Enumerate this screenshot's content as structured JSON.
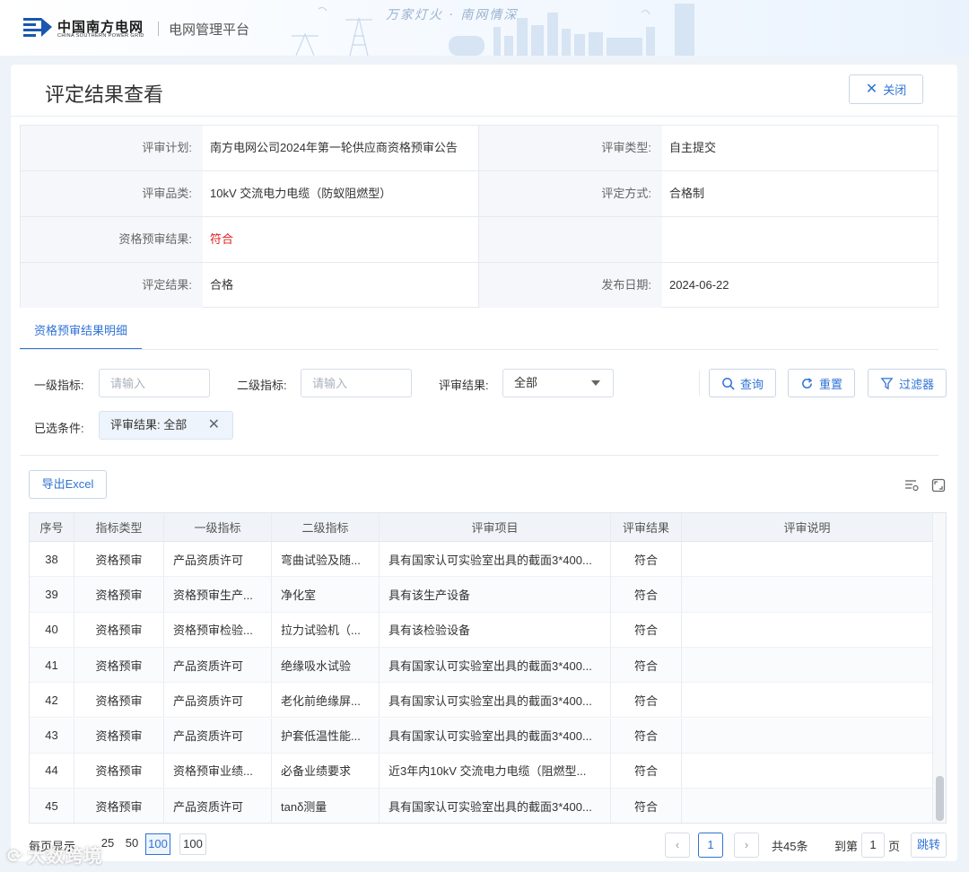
{
  "header": {
    "logo_cn": "中国南方电网",
    "logo_en": "CHINA SOUTHERN POWER GRID",
    "platform": "电网管理平台",
    "slogan": "万家灯火 · 南网情深"
  },
  "page": {
    "title": "评定结果查看",
    "close_label": "关闭"
  },
  "info": {
    "plan_label": "评审计划:",
    "plan_value": "南方电网公司2024年第一轮供应商资格预审公告",
    "type_label": "评审类型:",
    "type_value": "自主提交",
    "category_label": "评审品类:",
    "category_value": "10kV 交流电力电缆（防蚁阻燃型）",
    "method_label": "评定方式:",
    "method_value": "合格制",
    "prequal_label": "资格预审结果:",
    "prequal_value": "符合",
    "result_label": "评定结果:",
    "result_value": "合格",
    "date_label": "发布日期:",
    "date_value": "2024-06-22"
  },
  "tab": {
    "label": "资格预审结果明细"
  },
  "filters": {
    "level1_label": "一级指标:",
    "level1_placeholder": "请输入",
    "level2_label": "二级指标:",
    "level2_placeholder": "请输入",
    "result_label": "评审结果:",
    "result_value": "全部",
    "query_label": "查询",
    "reset_label": "重置",
    "filter_label": "过滤器",
    "selected_label": "已选条件:",
    "chip_text": "评审结果: 全部"
  },
  "toolbar": {
    "export_label": "导出Excel"
  },
  "table": {
    "headers": [
      "序号",
      "指标类型",
      "一级指标",
      "二级指标",
      "评审项目",
      "评审结果",
      "评审说明"
    ],
    "rows": [
      [
        "38",
        "资格预审",
        "产品资质许可",
        "弯曲试验及随...",
        "具有国家认可实验室出具的截面3*400...",
        "符合",
        ""
      ],
      [
        "39",
        "资格预审",
        "资格预审生产...",
        "净化室",
        "具有该生产设备",
        "符合",
        ""
      ],
      [
        "40",
        "资格预审",
        "资格预审检验...",
        "拉力试验机（...",
        "具有该检验设备",
        "符合",
        ""
      ],
      [
        "41",
        "资格预审",
        "产品资质许可",
        "绝缘吸水试验",
        "具有国家认可实验室出具的截面3*400...",
        "符合",
        ""
      ],
      [
        "42",
        "资格预审",
        "产品资质许可",
        "老化前绝缘屏...",
        "具有国家认可实验室出具的截面3*400...",
        "符合",
        ""
      ],
      [
        "43",
        "资格预审",
        "产品资质许可",
        "护套低温性能...",
        "具有国家认可实验室出具的截面3*400...",
        "符合",
        ""
      ],
      [
        "44",
        "资格预审",
        "资格预审业绩...",
        "必备业绩要求",
        "近3年内10kV 交流电力电缆（阻燃型...",
        "符合",
        ""
      ],
      [
        "45",
        "资格预审",
        "产品资质许可",
        "tanδ测量",
        "具有国家认可实验室出具的截面3*400...",
        "符合",
        ""
      ]
    ]
  },
  "pagination": {
    "per_page_label": "每页显示",
    "sizes": [
      "25",
      "50",
      "100"
    ],
    "active_size": "100",
    "size_input": "100",
    "prev": "‹",
    "current_page": "1",
    "next": "›",
    "total": "共45条",
    "goto_label": "到第",
    "goto_value": "1",
    "page_unit": "页",
    "jump_label": "跳转"
  },
  "watermark": {
    "text": "大数跨境"
  },
  "colors": {
    "accent": "#2f73d5",
    "danger": "#e02020",
    "header_bg": "#f6faff"
  }
}
